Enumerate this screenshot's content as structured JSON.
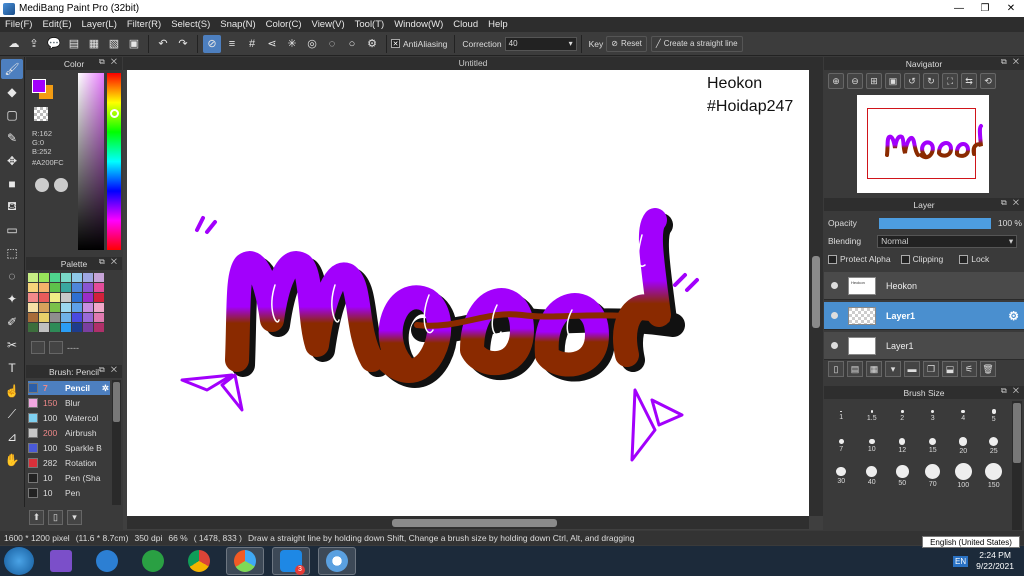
{
  "window": {
    "title": "MediBang Paint Pro (32bit)"
  },
  "menu": [
    "File(F)",
    "Edit(E)",
    "Layer(L)",
    "Filter(R)",
    "Select(S)",
    "Snap(N)",
    "Color(C)",
    "View(V)",
    "Tool(T)",
    "Window(W)",
    "Cloud",
    "Help"
  ],
  "toolbar": {
    "antialiasing_label": "AntiAliasing",
    "correction_label": "Correction",
    "correction_value": "40",
    "key_label": "Key",
    "reset_label": "Reset",
    "straight_line_label": "Create a straight line"
  },
  "color_panel": {
    "title": "Color",
    "r": "R:162",
    "g": "G:0",
    "b": "B:252",
    "hex": "#A200FC",
    "fg_color": "#A200FC",
    "bg_color": "#f39c12"
  },
  "palette_panel": {
    "title": "Palette",
    "footer": "----",
    "colors": [
      "#c7ee84",
      "#98e65a",
      "#4fd68e",
      "#7ad9c9",
      "#8fc9e8",
      "#9fa8e3",
      "#c7a4d8",
      "#f7d37a",
      "#f4b26a",
      "#5ec24b",
      "#3aa7a0",
      "#4e86d8",
      "#8a56d1",
      "#e34c9a",
      "#f28a8a",
      "#e85b5b",
      "#f0ed85",
      "#c9c9c9",
      "#2f6fd0",
      "#9b2dc8",
      "#d2213b",
      "#f5e0a6",
      "#d6a15b",
      "#7ac14a",
      "#9bd8f0",
      "#5ea0e8",
      "#c98ee0",
      "#f0a7c8",
      "#a86c3a",
      "#e8d06a",
      "#8e8e8e",
      "#6fb2e8",
      "#4a4ae0",
      "#9a6ad8",
      "#e07ab0",
      "#3c6e3c",
      "#c0c0c0",
      "#2e8b57",
      "#2a9df4",
      "#1e3c8c",
      "#7b3fa0",
      "#b0306a"
    ]
  },
  "brush_panel": {
    "title": "Brush: Pencil",
    "items": [
      {
        "size": "7",
        "name": "Pencil",
        "color": "#2b5ea8"
      },
      {
        "size": "150",
        "name": "Blur",
        "color": "#f2a7e0"
      },
      {
        "size": "100",
        "name": "Watercol",
        "color": "#7fd0f0"
      },
      {
        "size": "200",
        "name": "Airbrush",
        "color": "#c8c8c8"
      },
      {
        "size": "100",
        "name": "Sparkle B",
        "color": "#4a5ad8"
      },
      {
        "size": "282",
        "name": "Rotation",
        "color": "#d8303a"
      },
      {
        "size": "10",
        "name": "Pen (Sha",
        "color": "#222222"
      },
      {
        "size": "10",
        "name": "Pen",
        "color": "#222222"
      }
    ]
  },
  "canvas": {
    "tab_title": "Untitled",
    "watermark_line1": "Heokon",
    "watermark_line2": "#Hoidap247"
  },
  "navigator": {
    "title": "Navigator"
  },
  "layer_panel": {
    "title": "Layer",
    "opacity_label": "Opacity",
    "opacity_value": "100 %",
    "opacity": 1.0,
    "blending_label": "Blending",
    "blending_value": "Normal",
    "protect_alpha": "Protect Alpha",
    "clipping": "Clipping",
    "lock": "Lock",
    "layers": [
      "Heokon",
      "Layer1",
      "Layer1"
    ]
  },
  "brush_size_panel": {
    "title": "Brush Size",
    "sizes": [
      "1",
      "1.5",
      "2",
      "3",
      "4",
      "5",
      "7",
      "10",
      "12",
      "15",
      "20",
      "25",
      "30",
      "40",
      "50",
      "70",
      "100",
      "150"
    ]
  },
  "status": {
    "dimensions": "1600 * 1200 pixel",
    "physical": "(11.6 * 8.7cm)",
    "dpi": "350 dpi",
    "zoom": "66 %",
    "coords": "( 1478, 833 )",
    "hint": "Draw a straight line by holding down Shift, Change a brush size by holding down Ctrl, Alt, and dragging"
  },
  "taskbar": {
    "lang": "EN",
    "time": "2:24 PM",
    "date": "9/22/2021",
    "tooltip": "English (United States)",
    "zalo_badge": "3"
  },
  "colors": {
    "accent": "#4d7fbf",
    "stroke_purple": "#A200FC",
    "stroke_brown": "#8a2a00"
  }
}
